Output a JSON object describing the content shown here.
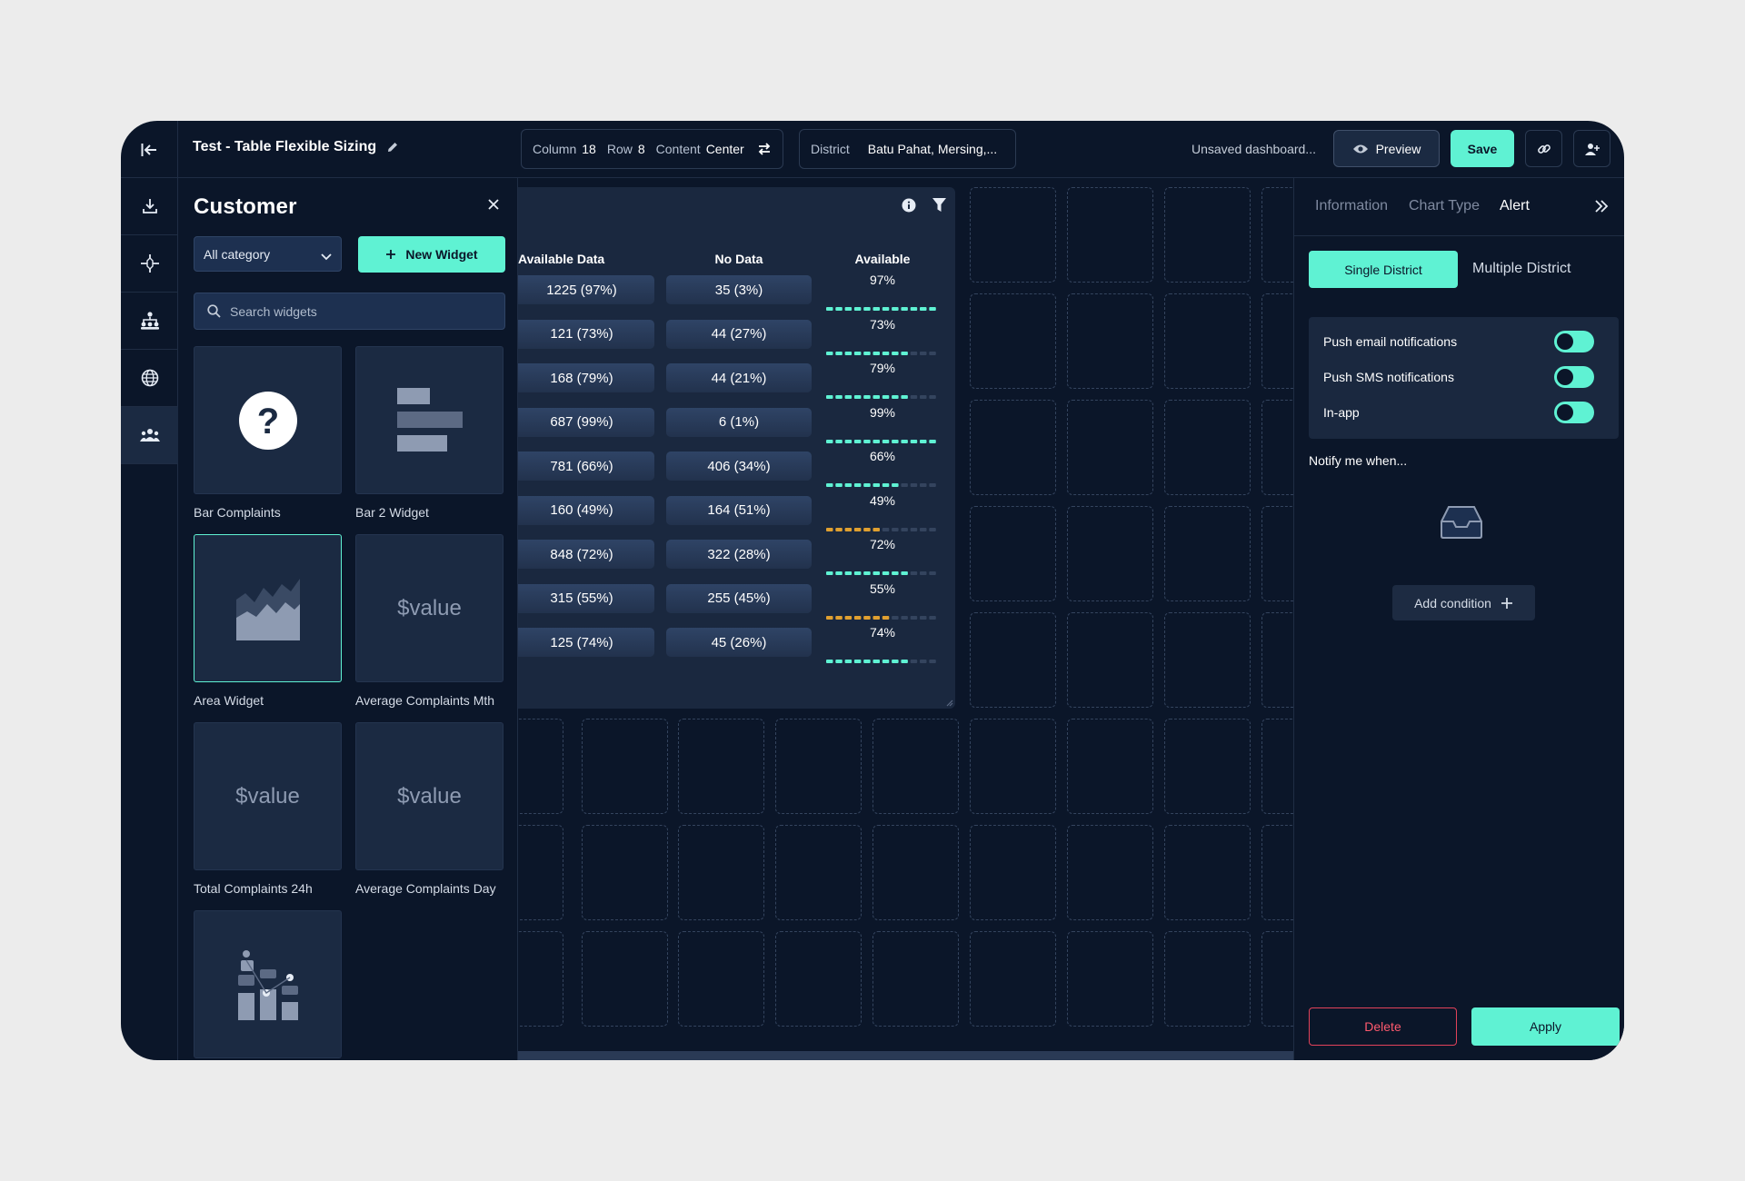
{
  "topbar": {
    "title": "Test - Table Flexible Sizing",
    "grid": {
      "column_label": "Column",
      "column_value": "18",
      "row_label": "Row",
      "row_value": "8",
      "content_label": "Content",
      "content_value": "Center"
    },
    "district": {
      "label": "District",
      "value": "Batu Pahat, Mersing,..."
    },
    "status": "Unsaved dashboard...",
    "preview_label": "Preview",
    "save_label": "Save"
  },
  "rail": {
    "items": [
      "download-icon",
      "nodes-icon",
      "hierarchy-icon",
      "globe-icon",
      "team-icon"
    ],
    "active_index": 4
  },
  "library": {
    "title": "Customer",
    "category": "All category",
    "new_widget_label": "New Widget",
    "search_placeholder": "Search widgets",
    "widgets": [
      {
        "name": "Bar Complaints",
        "thumb": "question-icon"
      },
      {
        "name": "Bar 2 Widget",
        "thumb": "bar-thumb-icon"
      },
      {
        "name": "Area Widget",
        "thumb": "area-thumb-icon",
        "selected": true
      },
      {
        "name": "Average Complaints Mth",
        "thumb": "$value"
      },
      {
        "name": "Total Complaints 24h",
        "thumb": "$value"
      },
      {
        "name": "Average Complaints Day",
        "thumb": "$value"
      },
      {
        "name": "",
        "thumb": "scatter-thumb-icon"
      }
    ]
  },
  "table": {
    "headers": [
      "Available Data",
      "No Data",
      "Available"
    ],
    "rows": [
      {
        "available_data": "1225 (97%)",
        "no_data": "35 (3%)",
        "available": "97%",
        "fraction": 0.97,
        "level": "ok"
      },
      {
        "available_data": "121 (73%)",
        "no_data": "44 (27%)",
        "available": "73%",
        "fraction": 0.73,
        "level": "ok"
      },
      {
        "available_data": "168 (79%)",
        "no_data": "44 (21%)",
        "available": "79%",
        "fraction": 0.79,
        "level": "ok"
      },
      {
        "available_data": "687 (99%)",
        "no_data": "6 (1%)",
        "available": "99%",
        "fraction": 0.99,
        "level": "ok"
      },
      {
        "available_data": "781 (66%)",
        "no_data": "406 (34%)",
        "available": "66%",
        "fraction": 0.66,
        "level": "ok"
      },
      {
        "available_data": "160 (49%)",
        "no_data": "164 (51%)",
        "available": "49%",
        "fraction": 0.49,
        "level": "warn"
      },
      {
        "available_data": "848 (72%)",
        "no_data": "322 (28%)",
        "available": "72%",
        "fraction": 0.72,
        "level": "ok"
      },
      {
        "available_data": "315 (55%)",
        "no_data": "255 (45%)",
        "available": "55%",
        "fraction": 0.55,
        "level": "warn"
      },
      {
        "available_data": "125 (74%)",
        "no_data": "45 (26%)",
        "available": "74%",
        "fraction": 0.74,
        "level": "ok"
      }
    ]
  },
  "props": {
    "tabs": [
      "Information",
      "Chart Type",
      "Alert"
    ],
    "active_tab": "Alert",
    "single_district": "Single District",
    "multiple_district": "Multiple District",
    "notifications": [
      {
        "label": "Push email notifications",
        "on": true
      },
      {
        "label": "Push SMS notifications",
        "on": true
      },
      {
        "label": "In-app",
        "on": true
      }
    ],
    "notify_label": "Notify me when...",
    "add_condition": "Add condition",
    "delete_label": "Delete",
    "apply_label": "Apply"
  },
  "colors": {
    "accent": "#5ff2d3",
    "danger": "#e2425a",
    "warn": "#e0a030",
    "bg": "#0b1629"
  }
}
